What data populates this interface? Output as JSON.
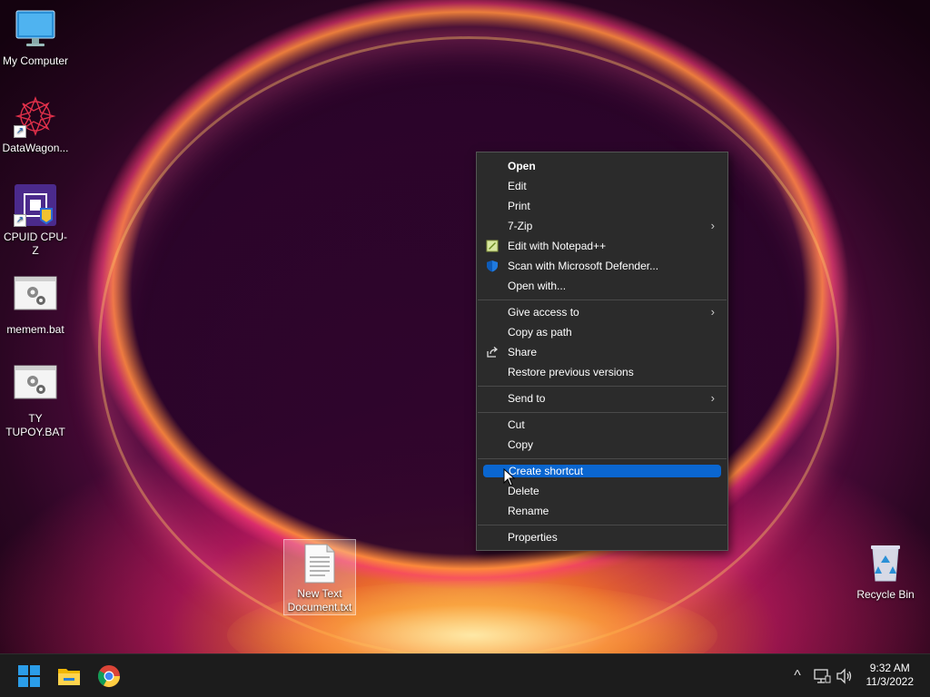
{
  "desktop": {
    "icons": [
      {
        "label": "My Computer",
        "icon": "monitor-icon"
      },
      {
        "label": "DataWagon...",
        "icon": "datawagon-icon"
      },
      {
        "label": "CPUID CPU-Z",
        "icon": "cpuz-icon"
      },
      {
        "label": "memem.bat",
        "icon": "batch-file-icon"
      },
      {
        "label": "TY\nTUPOY.BAT",
        "label_line1": "TY",
        "label_line2": "TUPOY.BAT",
        "icon": "batch-file-icon"
      }
    ],
    "selected_file": {
      "label_line1": "New Text",
      "label_line2": "Document.txt",
      "icon": "text-document-icon"
    },
    "recycle_bin": {
      "label": "Recycle Bin",
      "icon": "recycle-bin-icon"
    }
  },
  "context_menu": {
    "groups": [
      [
        {
          "label": "Open",
          "bold": true
        },
        {
          "label": "Edit"
        },
        {
          "label": "Print"
        },
        {
          "label": "7-Zip",
          "submenu": true
        },
        {
          "label": "Edit with Notepad++",
          "icon": "notepadpp-icon"
        },
        {
          "label": "Scan with Microsoft Defender...",
          "icon": "defender-shield-icon"
        },
        {
          "label": "Open with..."
        }
      ],
      [
        {
          "label": "Give access to",
          "submenu": true
        },
        {
          "label": "Copy as path"
        },
        {
          "label": "Share",
          "icon": "share-icon"
        },
        {
          "label": "Restore previous versions"
        }
      ],
      [
        {
          "label": "Send to",
          "submenu": true
        }
      ],
      [
        {
          "label": "Cut"
        },
        {
          "label": "Copy"
        }
      ],
      [
        {
          "label": "Create shortcut",
          "highlighted": true
        },
        {
          "label": "Delete"
        },
        {
          "label": "Rename"
        }
      ],
      [
        {
          "label": "Properties"
        }
      ]
    ],
    "submenu_glyph": "›",
    "highlight_color": "#0a66d0"
  },
  "taskbar": {
    "pinned": [
      {
        "name": "start",
        "icon": "windows-start-icon"
      },
      {
        "name": "file-explorer",
        "icon": "folder-icon"
      },
      {
        "name": "chrome",
        "icon": "chrome-icon"
      }
    ],
    "tray": {
      "chevron": "^",
      "icons": [
        "network-icon",
        "volume-icon"
      ]
    },
    "clock": {
      "time": "9:32 AM",
      "date": "11/3/2022"
    }
  },
  "colors": {
    "accent": "#0a66d0",
    "taskbar": "#1c1c1c",
    "menu_bg": "#2b2b2b"
  }
}
